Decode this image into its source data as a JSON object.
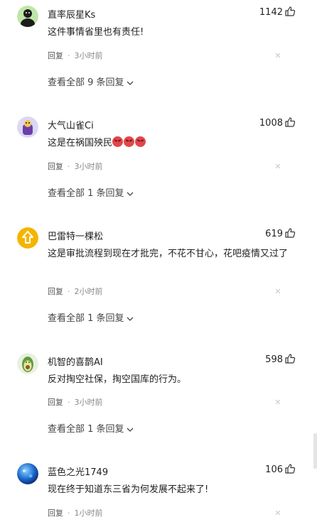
{
  "reply_label": "回复",
  "separator": "·",
  "comments": [
    {
      "username": "直率辰星Ks",
      "likes": "1142",
      "text": "这件事情省里也有责任!",
      "time": "3小时前",
      "replies_label": "查看全部 9 条回复"
    },
    {
      "username": "大气山雀Ci",
      "likes": "1008",
      "text": "这是在祸国殃民",
      "emoji_count": 3,
      "time": "3小时前",
      "replies_label": "查看全部 1 条回复"
    },
    {
      "username": "巴雷特一棵松",
      "likes": "619",
      "text": "这是审批流程到现在才批完，不花不甘心，花吧疫情又过了",
      "time": "2小时前",
      "replies_label": "查看全部 1 条回复"
    },
    {
      "username": "机智的喜鹊AI",
      "likes": "598",
      "text": "反对掏空社保，掏空国库的行为。",
      "time": "3小时前",
      "replies_label": "查看全部 1 条回复"
    },
    {
      "username": "蓝色之光1749",
      "likes": "106",
      "text": "现在终于知道东三省为何发展不起来了!",
      "time": "1小时前"
    }
  ]
}
